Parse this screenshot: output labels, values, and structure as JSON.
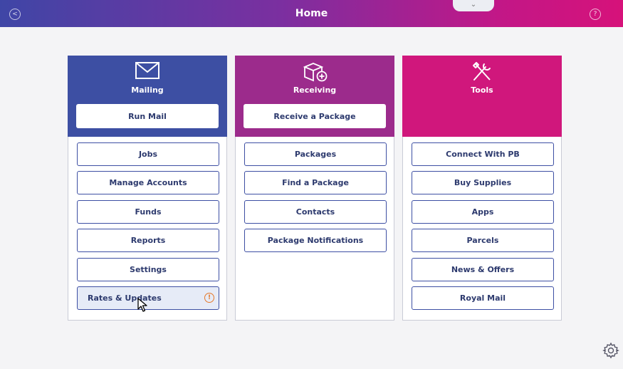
{
  "header": {
    "title": "Home",
    "back_icon": "back-arrow-icon",
    "help_icon": "help-icon",
    "pulltab_glyph": "⌄"
  },
  "colors": {
    "mailing": "#3d4fa3",
    "receiving": "#9c2b8c",
    "tools": "#d0177c",
    "warning": "#e5782a"
  },
  "mailing": {
    "title": "Mailing",
    "icon": "envelope-icon",
    "primary_action": "Run Mail",
    "items": [
      {
        "label": "Jobs"
      },
      {
        "label": "Manage Accounts"
      },
      {
        "label": "Funds"
      },
      {
        "label": "Reports"
      },
      {
        "label": "Settings"
      },
      {
        "label": "Rates & Updates",
        "alert": "!"
      }
    ]
  },
  "receiving": {
    "title": "Receiving",
    "icon": "package-add-icon",
    "primary_action": "Receive a Package",
    "items": [
      {
        "label": "Packages"
      },
      {
        "label": "Find a Package"
      },
      {
        "label": "Contacts"
      },
      {
        "label": "Package Notifications"
      }
    ]
  },
  "tools": {
    "title": "Tools",
    "icon": "tools-icon",
    "items": [
      {
        "label": "Connect With PB"
      },
      {
        "label": "Buy Supplies"
      },
      {
        "label": "Apps"
      },
      {
        "label": "Parcels"
      },
      {
        "label": "News & Offers"
      },
      {
        "label": "Royal Mail"
      }
    ]
  }
}
